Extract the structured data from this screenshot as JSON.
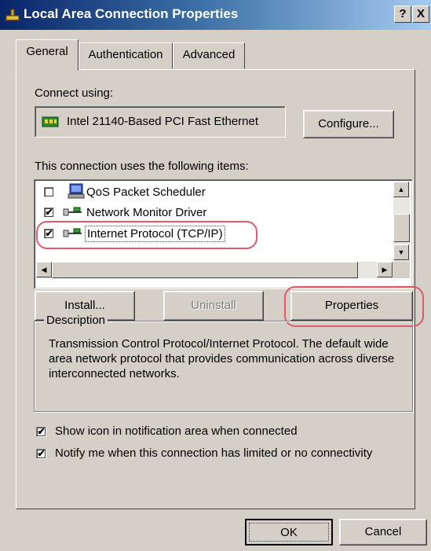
{
  "window": {
    "title": "Local Area Connection Properties",
    "help_btn": "?",
    "close_btn": "X"
  },
  "tabs": [
    {
      "label": "General",
      "active": true
    },
    {
      "label": "Authentication",
      "active": false
    },
    {
      "label": "Advanced",
      "active": false
    }
  ],
  "connect_using": {
    "label": "Connect using:",
    "adapter": "Intel 21140-Based PCI Fast Ethernet",
    "configure_btn": "Configure..."
  },
  "items_section": {
    "label": "This connection uses the following items:",
    "items": [
      {
        "label": "QoS Packet Scheduler",
        "checked": false,
        "icon": "scheduler-icon"
      },
      {
        "label": "Network Monitor Driver",
        "checked": true,
        "icon": "protocol-icon"
      },
      {
        "label": "Internet Protocol (TCP/IP)",
        "checked": true,
        "icon": "protocol-icon",
        "selected": true
      }
    ],
    "check_mark": "✔"
  },
  "buttons": {
    "install": "Install...",
    "uninstall": "Uninstall",
    "properties": "Properties"
  },
  "description": {
    "title": "Description",
    "text": "Transmission Control Protocol/Internet Protocol. The default wide area network protocol that provides communication across diverse interconnected networks."
  },
  "options": [
    {
      "label": "Show icon in notification area when connected",
      "checked": true
    },
    {
      "label": "Notify me when this connection has limited or no connectivity",
      "checked": true
    }
  ],
  "footer": {
    "ok": "OK",
    "cancel": "Cancel"
  },
  "colors": {
    "titlebar_start": "#0a246a",
    "titlebar_end": "#a6caf0",
    "face": "#d4d0c8",
    "highlight_annotation": "#e05a6a"
  }
}
